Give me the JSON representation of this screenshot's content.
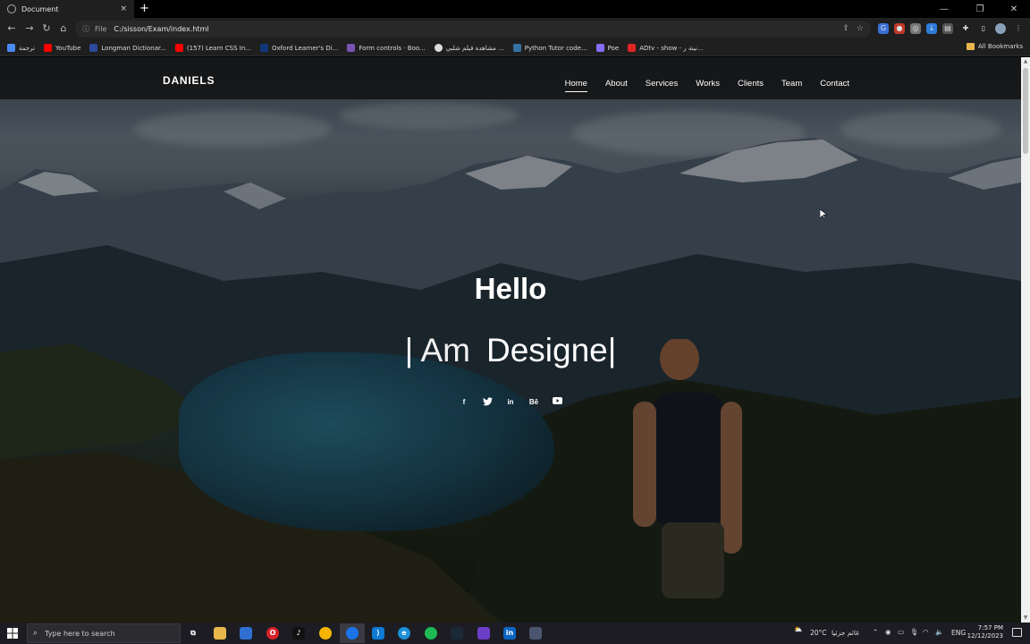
{
  "browser": {
    "tab": {
      "title": "Document",
      "close": "×"
    },
    "new_tab": "+",
    "window_controls": [
      "—",
      "❐",
      "✕"
    ],
    "address": {
      "scheme_label": "File",
      "url": "C:/sisson/Exam/index.html"
    }
  },
  "bookmarks": {
    "items": [
      {
        "label": "ترجمة",
        "color": "#4a8af4"
      },
      {
        "label": "YouTube",
        "color": "#ff0000"
      },
      {
        "label": "Longman Dictionar...",
        "color": "#2b4a9b"
      },
      {
        "label": "(157) Learn CSS In...",
        "color": "#ff0000"
      },
      {
        "label": "Oxford Learner's Di...",
        "color": "#0f3a7a"
      },
      {
        "label": "Form controls · Boo...",
        "color": "#7952b3"
      },
      {
        "label": "مشاهدة فيلم شلبي ...",
        "color": "#dddddd"
      },
      {
        "label": "Python Tutor code...",
        "color": "#3572a5"
      },
      {
        "label": "Poe",
        "color": "#8a6cff"
      },
      {
        "label": "ADtv - show - نيتة ر...",
        "color": "#e02424"
      }
    ],
    "all_label": "All Bookmarks"
  },
  "site": {
    "brand": "DANIELS",
    "menu": [
      {
        "label": "Home",
        "active": true
      },
      {
        "label": "About",
        "active": false
      },
      {
        "label": "Services",
        "active": false
      },
      {
        "label": "Works",
        "active": false
      },
      {
        "label": "Clients",
        "active": false
      },
      {
        "label": "Team",
        "active": false
      },
      {
        "label": "Contact",
        "active": false
      }
    ],
    "hero": {
      "greeting": "Hello",
      "prefix": "| Am",
      "typed_word": "Designe",
      "caret": "|"
    },
    "socials": [
      {
        "name": "facebook-icon",
        "glyph": "f"
      },
      {
        "name": "twitter-icon",
        "glyph": "🐦"
      },
      {
        "name": "linkedin-icon",
        "glyph": "in"
      },
      {
        "name": "behance-icon",
        "glyph": "Bē"
      },
      {
        "name": "youtube-icon",
        "glyph": "▶"
      }
    ]
  },
  "taskbar": {
    "search_placeholder": "Type here to search",
    "weather": "20°C",
    "weather_label": "غائم جزئيا",
    "language": "ENG",
    "time": "7:57 PM",
    "date": "12/12/2023"
  }
}
